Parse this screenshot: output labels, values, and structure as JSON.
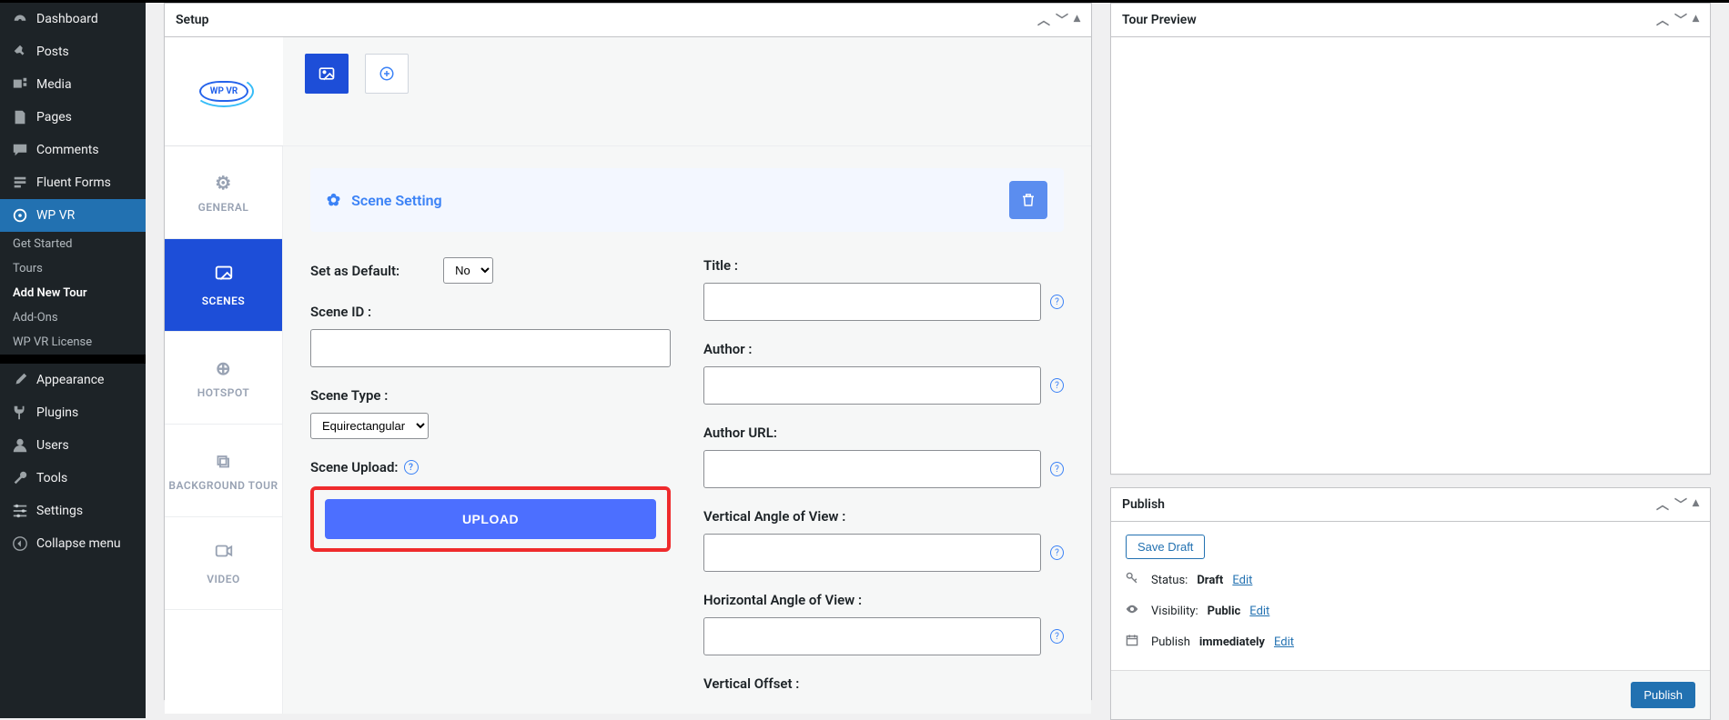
{
  "sidebar": {
    "items": [
      {
        "label": "Dashboard",
        "icon": "◉"
      },
      {
        "label": "Posts",
        "icon": "✎"
      },
      {
        "label": "Media",
        "icon": "🖾"
      },
      {
        "label": "Pages",
        "icon": "▤"
      },
      {
        "label": "Comments",
        "icon": "❝"
      },
      {
        "label": "Fluent Forms",
        "icon": "▦"
      },
      {
        "label": "WP VR",
        "icon": "◎"
      }
    ],
    "sub": [
      "Get Started",
      "Tours",
      "Add New Tour",
      "Add-Ons",
      "WP VR License"
    ],
    "lower": [
      {
        "label": "Appearance",
        "icon": "✐"
      },
      {
        "label": "Plugins",
        "icon": "✦"
      },
      {
        "label": "Users",
        "icon": "👤"
      },
      {
        "label": "Tools",
        "icon": "🔧"
      },
      {
        "label": "Settings",
        "icon": "☰"
      },
      {
        "label": "Collapse menu",
        "icon": "◀"
      }
    ]
  },
  "setup": {
    "title": "Setup",
    "logo": "WP VR",
    "side_tabs": [
      "GENERAL",
      "SCENES",
      "HOTSPOT",
      "BACKGROUND TOUR",
      "VIDEO"
    ],
    "scene_setting": "Scene Setting",
    "fields": {
      "default_label": "Set as Default:",
      "default_value": "No",
      "scene_id": "Scene ID :",
      "scene_type": "Scene Type :",
      "scene_type_value": "Equirectangular",
      "scene_upload": "Scene Upload:",
      "upload_btn": "UPLOAD",
      "title": "Title :",
      "author": "Author :",
      "author_url": "Author URL:",
      "vangle": "Vertical Angle of View :",
      "hangle": "Horizontal Angle of View :",
      "voffset": "Vertical Offset :"
    }
  },
  "preview": {
    "title": "Tour Preview"
  },
  "publish": {
    "title": "Publish",
    "save_draft": "Save Draft",
    "status_label": "Status:",
    "status_value": "Draft",
    "edit": "Edit",
    "visibility_label": "Visibility:",
    "visibility_value": "Public",
    "publish_label": "Publish",
    "publish_when": "immediately",
    "publish_btn": "Publish"
  }
}
